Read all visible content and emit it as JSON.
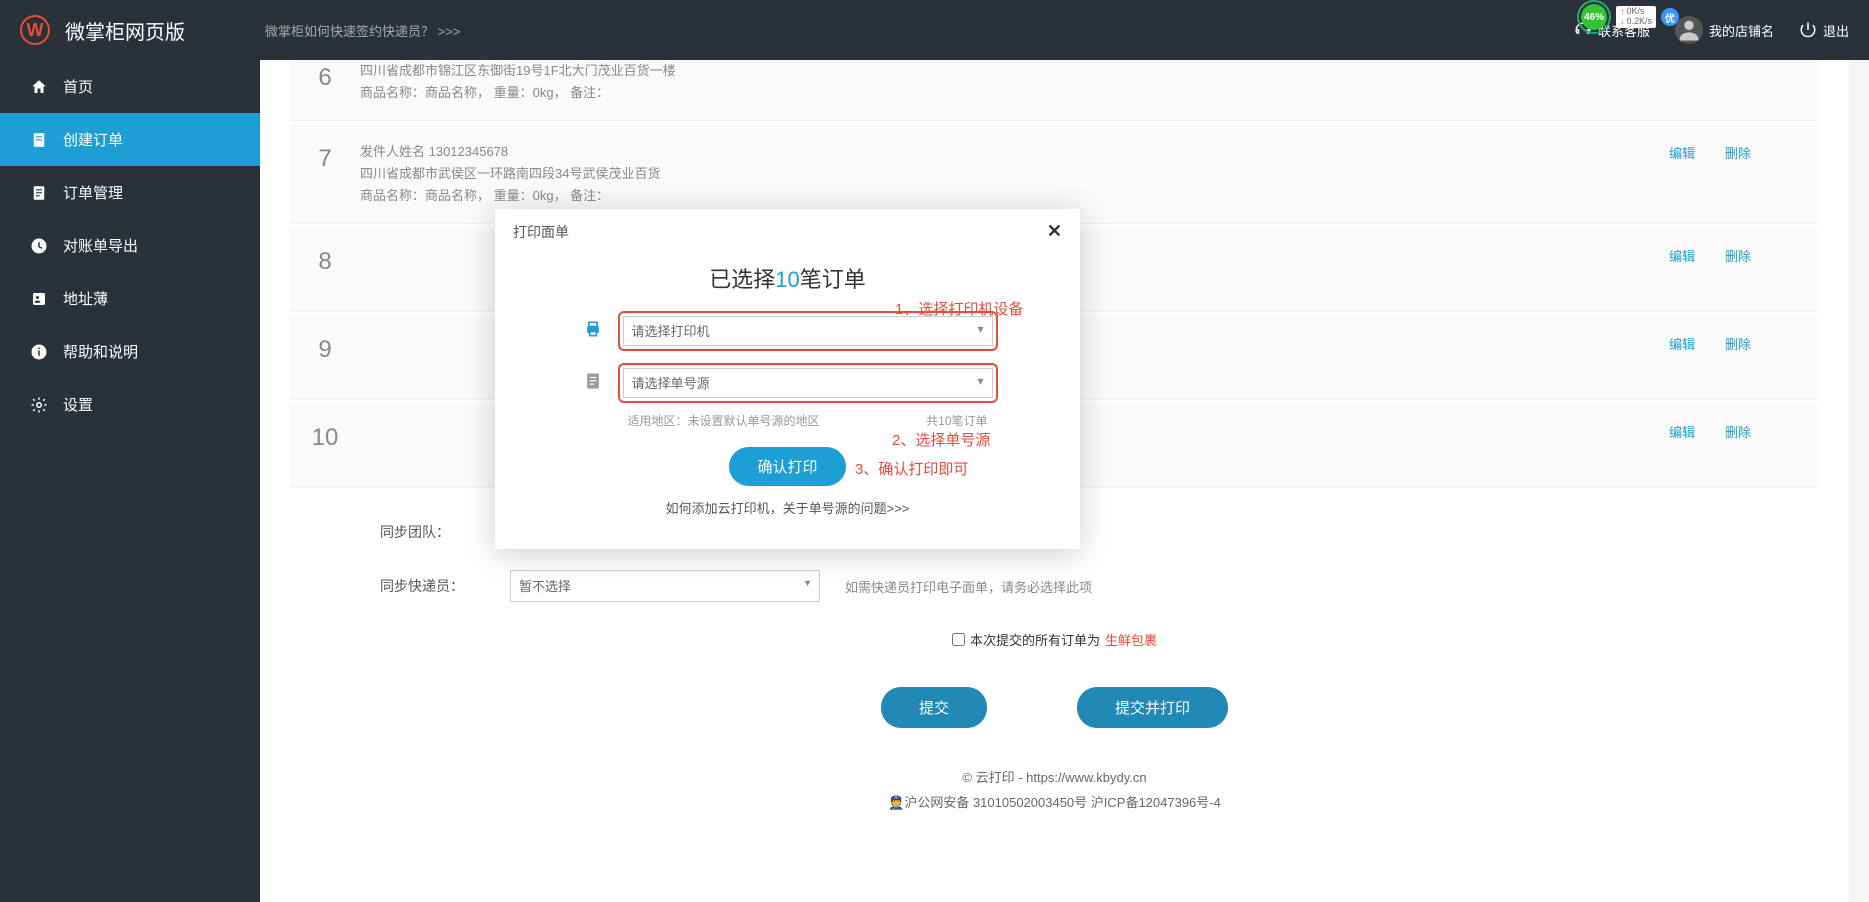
{
  "header": {
    "app_title": "微掌柜网页版",
    "link": "微掌柜如何快速签约快递员？ >>>",
    "contact": "联系客服",
    "shop": "我的店铺名",
    "logout": "退出",
    "net_percent": "46%",
    "net_up": "0K/s",
    "net_down": "0.2K/s"
  },
  "sidebar": {
    "items": [
      {
        "label": "首页"
      },
      {
        "label": "创建订单"
      },
      {
        "label": "订单管理"
      },
      {
        "label": "对账单导出"
      },
      {
        "label": "地址薄"
      },
      {
        "label": "帮助和说明"
      },
      {
        "label": "设置"
      }
    ]
  },
  "orders": [
    {
      "num": "6",
      "line1": "四川省成都市锦江区东御街19号1F北大门茂业百货一楼",
      "line2": "商品名称：商品名称，  重量：0kg，  备注：",
      "partial": true
    },
    {
      "num": "7",
      "line0": "发件人姓名  13012345678",
      "line1": "四川省成都市武侯区一环路南四段34号武侯茂业百货",
      "line2": "商品名称：商品名称，  重量：0kg，  备注："
    },
    {
      "num": "8"
    },
    {
      "num": "9"
    },
    {
      "num": "10"
    }
  ],
  "actions": {
    "edit": "编辑",
    "delete": "删除"
  },
  "form": {
    "sync_team": "同步团队：",
    "sync_courier": "同步快递员：",
    "courier_placeholder": "暂不选择",
    "courier_hint": "如需快递员打印电子面单，请务必选择此项",
    "fresh_prefix": "本次提交的所有订单为",
    "fresh_red": "生鲜包裹",
    "submit": "提交",
    "submit_print": "提交并打印"
  },
  "footer": {
    "line1": "© 云打印 - https://www.kbydy.cn",
    "line2": "沪公网安备 31010502003450号 沪ICP备12047396号-4"
  },
  "modal": {
    "header": "打印面单",
    "title_prefix": "已选择",
    "title_count": "10",
    "title_suffix": "笔订单",
    "printer_placeholder": "请选择打印机",
    "source_placeholder": "请选择单号源",
    "sub_left": "适用地区：未设置默认单号源的地区",
    "sub_right": "共10笔订单",
    "confirm": "确认打印",
    "help": "如何添加云打印机，关于单号源的问题>>>"
  },
  "annotations": {
    "a1": "1、选择打印机设备",
    "a2": "2、选择单号源",
    "a3": "3、确认打印即可"
  }
}
